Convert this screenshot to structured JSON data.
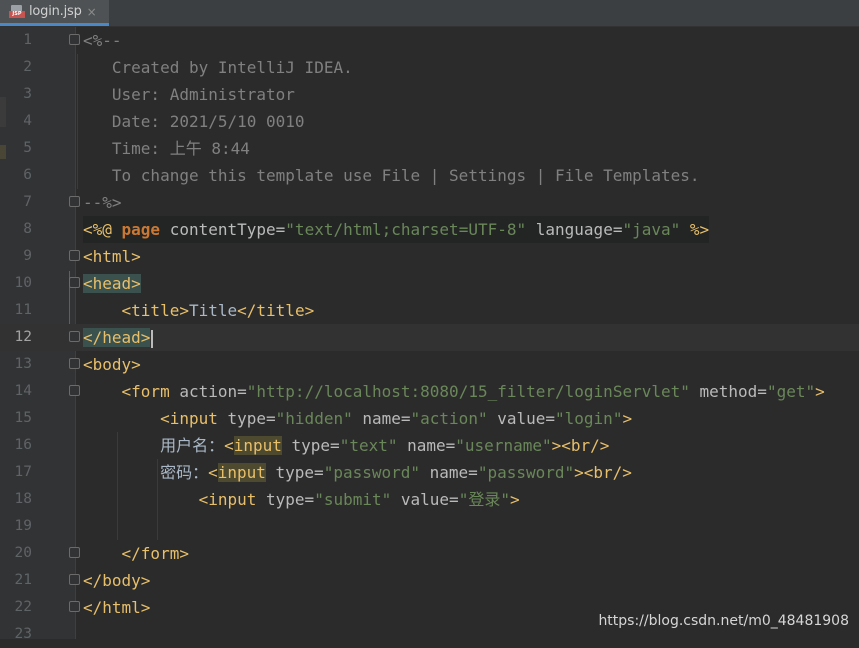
{
  "tab": {
    "filename": "login.jsp",
    "close_glyph": "×",
    "icon": "jsp-file-icon"
  },
  "lines": [
    {
      "n": "1"
    },
    {
      "n": "2"
    },
    {
      "n": "3"
    },
    {
      "n": "4"
    },
    {
      "n": "5"
    },
    {
      "n": "6"
    },
    {
      "n": "7"
    },
    {
      "n": "8"
    },
    {
      "n": "9"
    },
    {
      "n": "10"
    },
    {
      "n": "11"
    },
    {
      "n": "12"
    },
    {
      "n": "13"
    },
    {
      "n": "14"
    },
    {
      "n": "15"
    },
    {
      "n": "16"
    },
    {
      "n": "17"
    },
    {
      "n": "18"
    },
    {
      "n": "19"
    },
    {
      "n": "20"
    },
    {
      "n": "21"
    },
    {
      "n": "22"
    },
    {
      "n": "23"
    }
  ],
  "code": {
    "l1": "<%--",
    "l2": "   Created by IntelliJ IDEA.",
    "l3": "   User: Administrator",
    "l4": "   Date: 2021/5/10 0010",
    "l5": "   Time: 上午 8:44",
    "l6": "   To change this template use File | Settings | File Templates.",
    "l7": "--%>",
    "l8": {
      "open": "<%@ ",
      "page": "page",
      "a1": " contentType=",
      "v1": "\"text/html;charset=UTF-8\"",
      "a2": " language=",
      "v2": "\"java\"",
      "close": " %>"
    },
    "l9": "<html>",
    "l10": "<head>",
    "l11": {
      "indent": "    ",
      "t1": "<title>",
      "txt": "Title",
      "t2": "</title>"
    },
    "l12": "</head>",
    "l13": "<body>",
    "l14": {
      "indent": "    ",
      "tag": "<form",
      "a1": " action=",
      "v1": "\"http://localhost:8080/15_filter/loginServlet\"",
      "a2": " method=",
      "v2": "\"get\"",
      "end": ">"
    },
    "l15": {
      "indent": "        ",
      "tag": "<input",
      "a1": " type=",
      "v1": "\"hidden\"",
      "a2": " name=",
      "v2": "\"action\"",
      "a3": " value=",
      "v3": "\"login\"",
      "end": ">"
    },
    "l16": {
      "indent": "        ",
      "label": "用户名：",
      "lt": "<",
      "tagname": "input",
      "a1": " type=",
      "v1": "\"text\"",
      "a2": " name=",
      "v2": "\"username\"",
      "end": "><br/>"
    },
    "l17": {
      "indent": "        ",
      "label": "密码：",
      "lt": "<",
      "tagname": "input",
      "a1": " type=",
      "v1": "\"password\"",
      "a2": " name=",
      "v2": "\"password\"",
      "end": "><br/>"
    },
    "l18": {
      "indent": "            ",
      "tag": "<input",
      "a1": " type=",
      "v1": "\"submit\"",
      "a2": " value=",
      "v2": "\"登录\"",
      "end": ">"
    },
    "l19": "",
    "l20": {
      "indent": "    ",
      "tag": "</form>"
    },
    "l21": "</body>",
    "l22": "</html>",
    "l23": ""
  },
  "watermark": "https://blog.csdn.net/m0_48481908",
  "colors": {
    "background": "#2b2b2b",
    "gutter": "#313335",
    "comment": "#808080",
    "tag": "#e8bf6a",
    "attribute": "#bababa",
    "string": "#6a8759",
    "keyword": "#cc7832"
  }
}
